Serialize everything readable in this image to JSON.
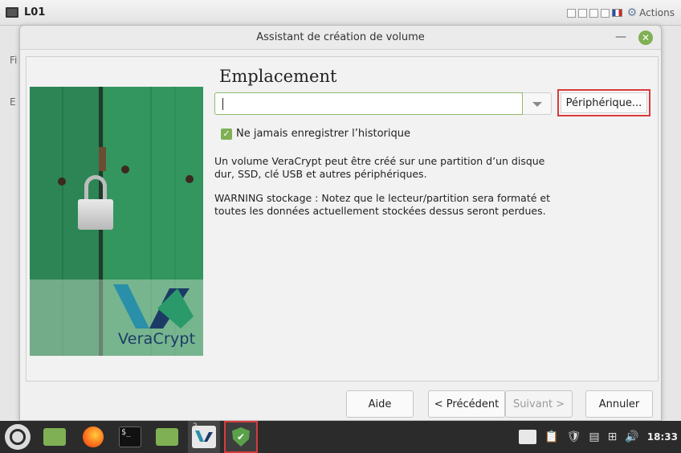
{
  "vm": {
    "title": "L01",
    "actions_label": "Actions",
    "bg_menu_first": "Fi",
    "bg_menu_second": "E"
  },
  "dialog": {
    "title": "Assistant de création de volume",
    "heading": "Emplacement",
    "path_input": {
      "value": "",
      "placeholder": ""
    },
    "device_button": "Périphérique...",
    "checkbox": {
      "label": "Ne jamais enregistrer l’historique",
      "checked": true
    },
    "paragraph1": "Un volume VeraCrypt peut être créé sur une partition d’un disque dur, SSD, clé USB et autres périphériques.",
    "paragraph2": "WARNING stockage : Notez que le lecteur/partition sera formaté et toutes les données actuellement stockées dessus seront perdues.",
    "image_brand": "VeraCrypt",
    "buttons": {
      "help": "Aide",
      "previous": "< Précédent",
      "next": "Suivant >",
      "cancel": "Annuler"
    }
  },
  "taskbar": {
    "veracrypt_window_count": "2",
    "clock": "18:33",
    "icons": [
      "mint-menu-icon",
      "folder-icon",
      "firefox-icon",
      "terminal-icon",
      "folder-icon",
      "veracrypt-icon",
      "shield-icon"
    ],
    "tray_icons": [
      "veracrypt-tray-icon",
      "clipboard-icon",
      "shield-tray-icon",
      "notes-icon",
      "network-icon",
      "volume-icon"
    ]
  },
  "colors": {
    "accent_green": "#7fb054",
    "highlight_red": "#d93a3a",
    "taskbar": "#2b2b2b"
  }
}
